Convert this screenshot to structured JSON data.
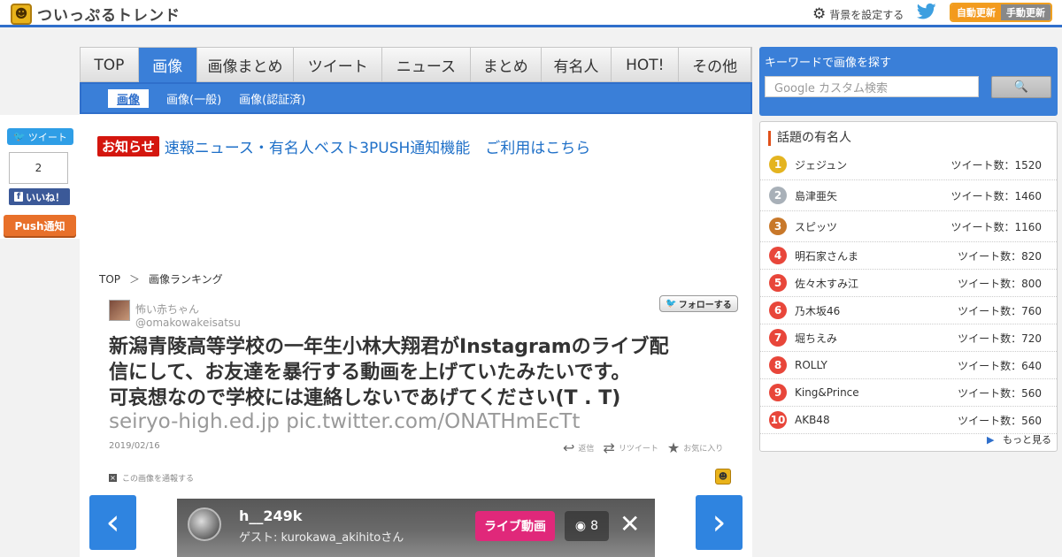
{
  "header": {
    "site_name": "ついっぷるトレンド",
    "background_setting": "背景を設定する",
    "auto_update": "自動更新",
    "manual_update": "手動更新"
  },
  "share": {
    "tweet_label": "ツイート",
    "like_count": "2",
    "like_label": "いいね！",
    "push_label": "Push通知"
  },
  "nav": {
    "tabs": [
      {
        "label": "TOP",
        "width": 66
      },
      {
        "label": "画像",
        "width": 66,
        "active": true
      },
      {
        "label": "画像まとめ",
        "width": 110
      },
      {
        "label": "ツイート",
        "width": 100
      },
      {
        "label": "ニュース",
        "width": 100
      },
      {
        "label": "まとめ",
        "width": 80
      },
      {
        "label": "有名人",
        "width": 80
      },
      {
        "label": "HOT!",
        "width": 76
      },
      {
        "label": "その他",
        "width": 82
      }
    ],
    "sub_items": [
      "画像",
      "画像(一般)",
      "画像(認証済)"
    ]
  },
  "notice": {
    "badge": "お知らせ",
    "text": "速報ニュース・有名人ベスト3PUSH通知機能　ご利用はこちら"
  },
  "breadcrumb": {
    "home": "TOP",
    "sep": "＞",
    "current": "画像ランキング"
  },
  "tweet": {
    "author_name": "怖い赤ちゃん",
    "author_handle": "@omakowakeisatsu",
    "follow_label": "フォローする",
    "text_lines": [
      "新潟青陵高等学校の一年生小林大翔君がInstagramのライブ配",
      "信にして、お友達を暴行する動画を上げていたみたいです。",
      "可哀想なので学校には連絡しないであげてください(T . T)"
    ],
    "link_text": "seiryo-high.ed.jp pic.twitter.com/ONATHmEcTt",
    "date": "2019/02/16",
    "reply_label": "返信",
    "retweet_label": "リツイート",
    "favorite_label": "お気に入り",
    "report_label": "この画像を通報する"
  },
  "image": {
    "username": "h__249k",
    "guest_text": "ゲスト: kurokawa_akihitoさん",
    "live_label": "ライブ動画",
    "view_count": "8"
  },
  "search": {
    "title": "キーワードで画像を探す",
    "placeholder": "Google カスタム検索"
  },
  "celebs": {
    "title": "話題の有名人",
    "count_prefix": "ツイート数：",
    "items": [
      {
        "rank": "1",
        "name": "ジェジュン",
        "count": "1520",
        "style": "gold"
      },
      {
        "rank": "2",
        "name": "島津亜矢",
        "count": "1460",
        "style": "silver"
      },
      {
        "rank": "3",
        "name": "スピッツ",
        "count": "1160",
        "style": "bronze"
      },
      {
        "rank": "4",
        "name": "明石家さんま",
        "count": "820",
        "style": "red"
      },
      {
        "rank": "5",
        "name": "佐々木すみ江",
        "count": "800",
        "style": "red"
      },
      {
        "rank": "6",
        "name": "乃木坂46",
        "count": "760",
        "style": "red"
      },
      {
        "rank": "7",
        "name": "堀ちえみ",
        "count": "720",
        "style": "red"
      },
      {
        "rank": "8",
        "name": "ROLLY",
        "count": "640",
        "style": "red"
      },
      {
        "rank": "9",
        "name": "King&Prince",
        "count": "560",
        "style": "red"
      },
      {
        "rank": "10",
        "name": "AKB48",
        "count": "560",
        "style": "red"
      }
    ],
    "more_label": "もっと見る"
  },
  "colors": {
    "accent": "#3a7fd8",
    "notice_red": "#d4160e",
    "link_blue": "#1f70c8"
  }
}
